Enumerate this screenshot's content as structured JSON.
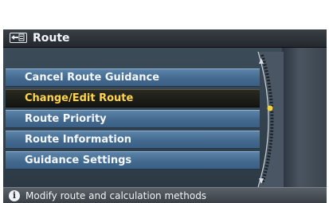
{
  "title_bar": {
    "title": "Route",
    "icon": "route-icon"
  },
  "menu": {
    "items": [
      {
        "label": "Cancel Route Guidance",
        "selected": false
      },
      {
        "label": "Change/Edit Route",
        "selected": true
      },
      {
        "label": "Route Priority",
        "selected": false
      },
      {
        "label": "Route Information",
        "selected": false
      },
      {
        "label": "Guidance Settings",
        "selected": false
      }
    ]
  },
  "status_bar": {
    "icon": "info-icon",
    "text": "Modify route and calculation methods"
  },
  "colors": {
    "menu_item": "#4f7699",
    "selected_item": "#1c1c17",
    "selected_text": "#ffd54a",
    "selection_dot": "#f5d33a",
    "title_bar": "#2c3036"
  }
}
